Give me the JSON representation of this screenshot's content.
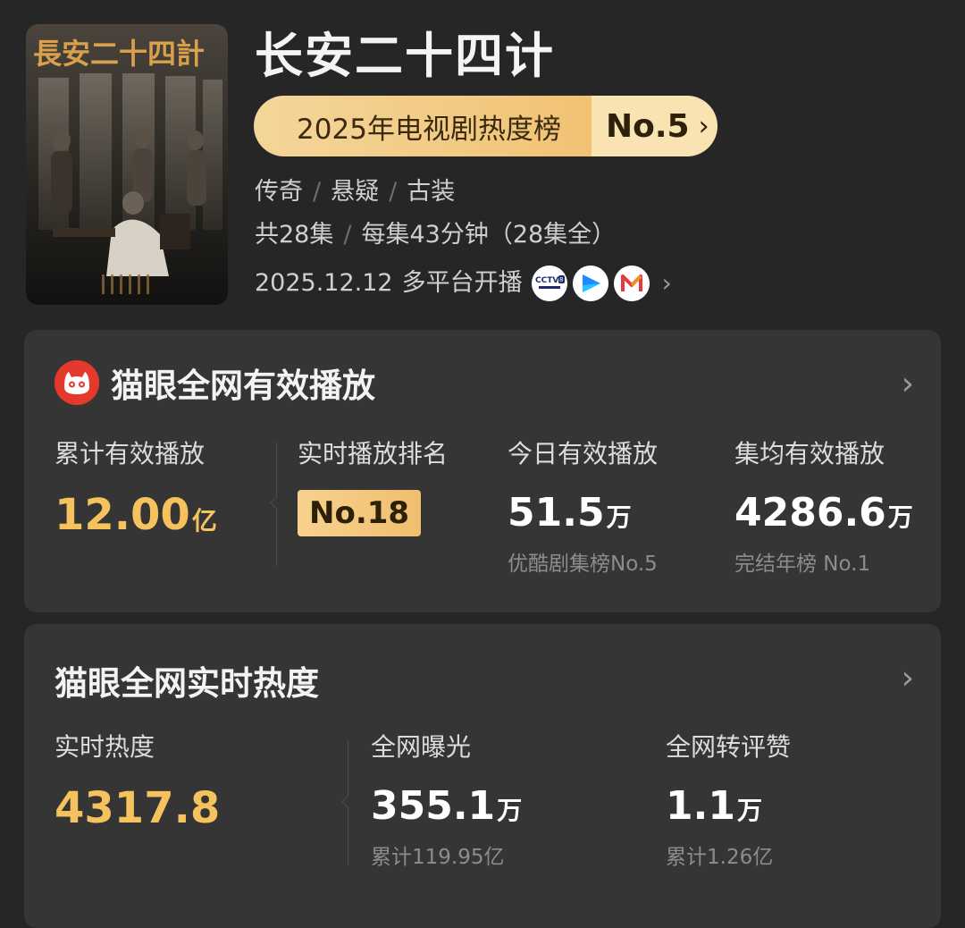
{
  "show": {
    "title": "长安二十四计",
    "poster_title_art": "長安二十四計",
    "rank_label": "2025年电视剧热度榜",
    "rank_value": "No.5",
    "genres": [
      "传奇",
      "悬疑",
      "古装"
    ],
    "episodes": "共28集",
    "episode_info": "每集43分钟（28集全）",
    "release_date": "2025.12.12",
    "release_text": "多平台开播",
    "platforms": [
      {
        "name": "CCTV-8",
        "icon": "cctv8-icon"
      },
      {
        "name": "优酷",
        "icon": "youku-icon"
      },
      {
        "name": "芒果TV",
        "icon": "mgtv-icon"
      }
    ]
  },
  "playback": {
    "title": "猫眼全网有效播放",
    "stats": [
      {
        "label": "累计有效播放",
        "value": "12.00",
        "unit": "亿",
        "sub": ""
      },
      {
        "label": "实时播放排名",
        "value": "No.18",
        "unit": "",
        "sub": ""
      },
      {
        "label": "今日有效播放",
        "value": "51.5",
        "unit": "万",
        "sub": "优酷剧集榜No.5"
      },
      {
        "label": "集均有效播放",
        "value": "4286.6",
        "unit": "万",
        "sub": "完结年榜 No.1"
      }
    ]
  },
  "heat": {
    "title": "猫眼全网实时热度",
    "stats": [
      {
        "label": "实时热度",
        "value": "4317.8",
        "unit": "",
        "sub": ""
      },
      {
        "label": "全网曝光",
        "value": "355.1",
        "unit": "万",
        "sub": "累计119.95亿"
      },
      {
        "label": "全网转评赞",
        "value": "1.1",
        "unit": "万",
        "sub": "累计1.26亿"
      }
    ]
  },
  "icons": {
    "chevron": "›",
    "cat_logo": "maoyan-cat-icon"
  },
  "colors": {
    "accent_gold": "#f6c25d",
    "background": "#262626",
    "card": "#353535",
    "maoyan_red": "#e5392c"
  }
}
